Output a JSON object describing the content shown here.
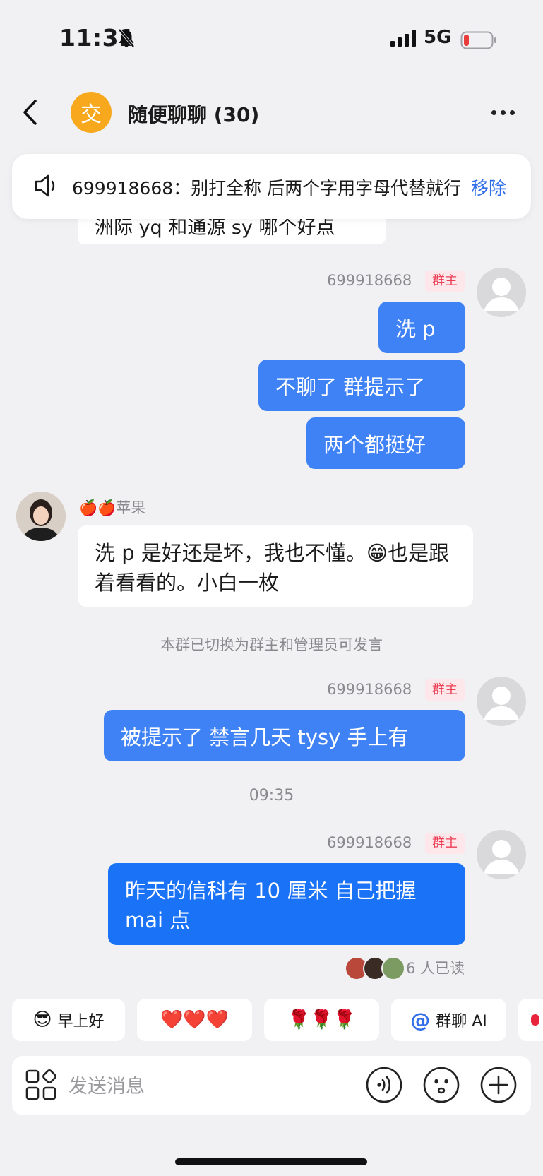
{
  "status": {
    "time": "11:31",
    "network": "5G"
  },
  "header": {
    "avatar_char": "交",
    "title": "随便聊聊 (30)"
  },
  "notice": {
    "text": "699918668：别打全称 后两个字用字母代替就行",
    "remove_label": "移除"
  },
  "previous_message": "洲际 yq 和通源 sy 哪个好点",
  "messages": {
    "group1": {
      "sender": "699918668",
      "badge": "群主",
      "bubbles": [
        "洗 p",
        "不聊了 群提示了",
        "两个都挺好"
      ]
    },
    "group2": {
      "sender": "🍎🍎苹果",
      "text": "洗 p 是好还是坏，我也不懂。😁也是跟着看看的。小白一枚"
    },
    "system_notice": "本群已切换为群主和管理员可发言",
    "group3": {
      "sender": "699918668",
      "badge": "群主",
      "text": "被提示了 禁言几天  tysy 手上有"
    },
    "timestamp": "09:35",
    "group4": {
      "sender": "699918668",
      "badge": "群主",
      "text": "昨天的信科有 10 厘米 自己把握 mai 点",
      "read_receipt": "6 人已读"
    }
  },
  "quick_replies": {
    "morning": "早上好",
    "hearts": "❤️❤️❤️",
    "roses": "🌹🌹🌹",
    "ai": "群聊 AI"
  },
  "input": {
    "placeholder": "发送消息"
  },
  "colors": {
    "my_bubble": "#3f82f5",
    "owner_badge_bg": "#fde7ea",
    "owner_badge_text": "#ec3f55",
    "link_blue": "#2f6ee8"
  }
}
